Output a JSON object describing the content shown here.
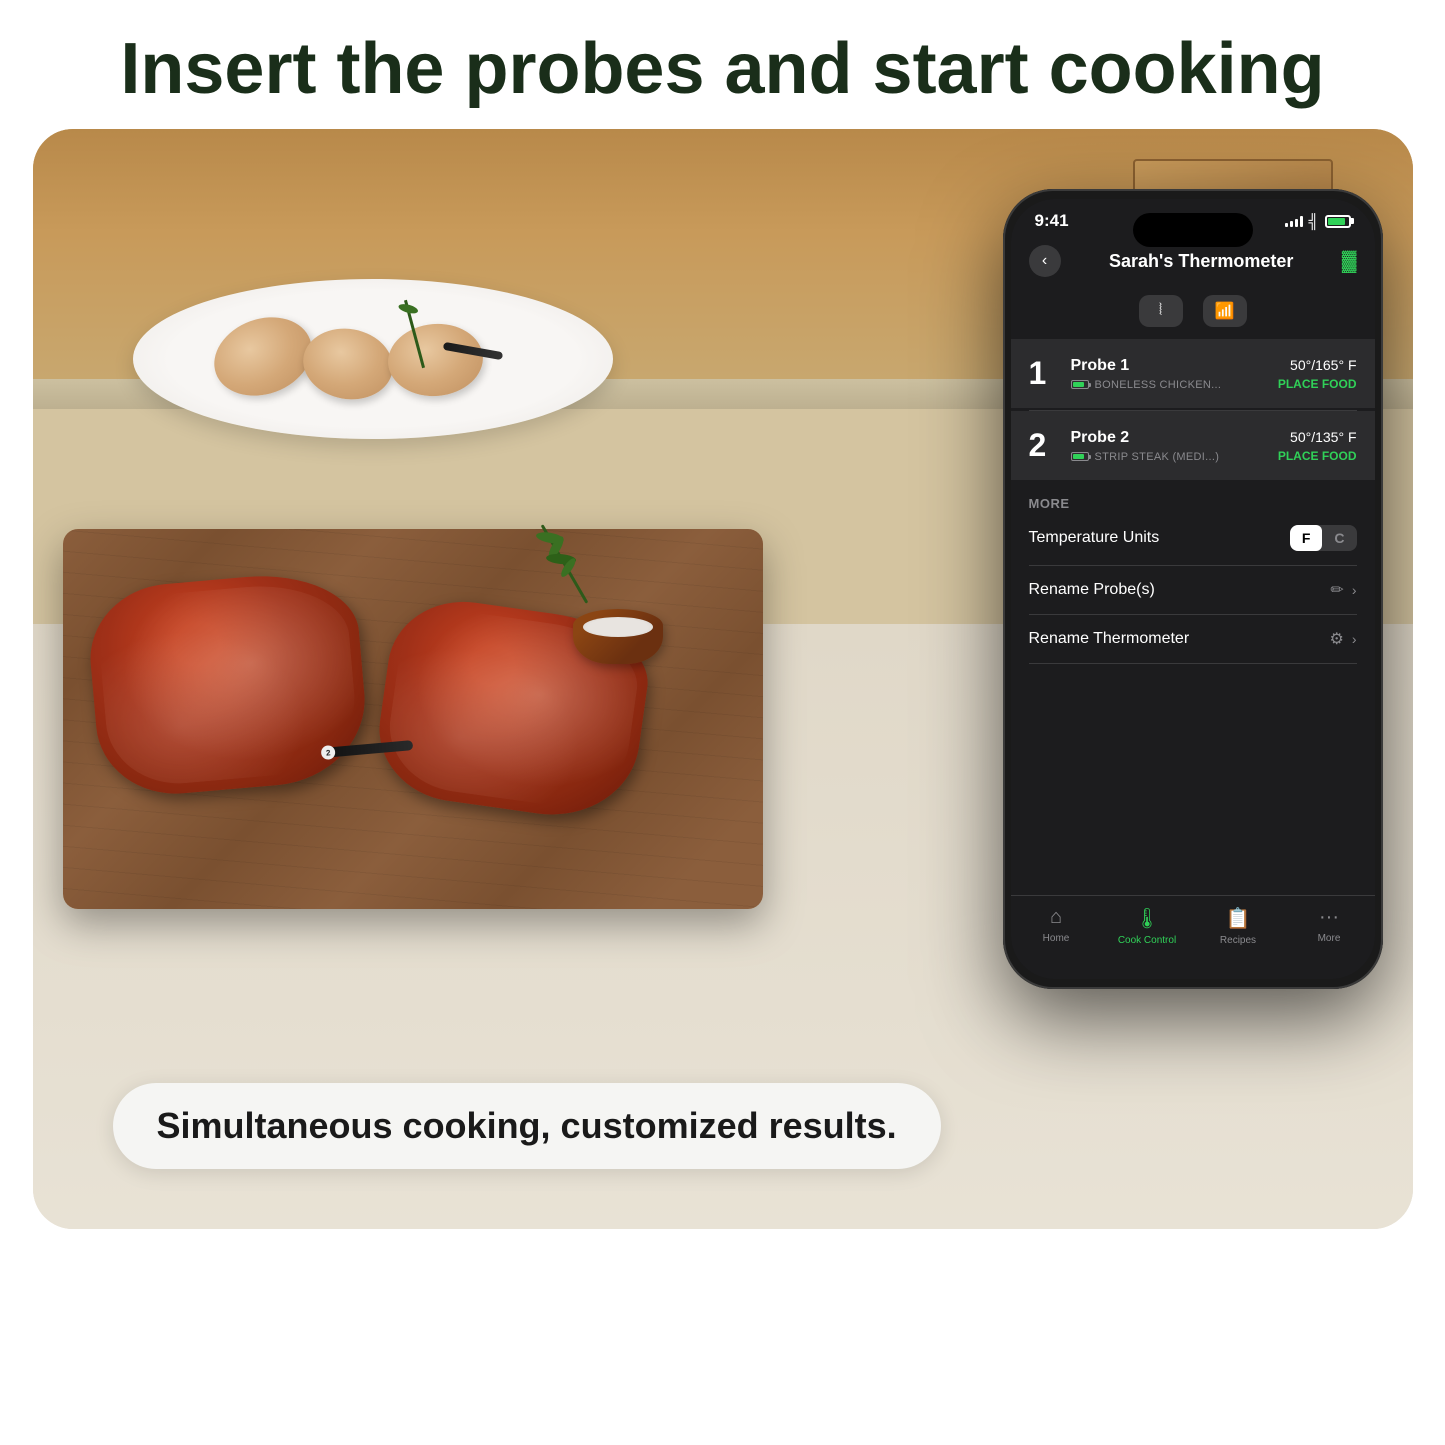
{
  "headline": "Insert the probes and start cooking",
  "tagline": "Simultaneous cooking, customized results.",
  "phone": {
    "status_time": "9:41",
    "title": "Sarah's Thermometer",
    "back_label": "‹",
    "battery_label": "🔋",
    "connectivity": {
      "bluetooth_label": "Bluetooth",
      "wifi_label": "WiFi"
    },
    "probes": [
      {
        "number": "1",
        "name": "Probe 1",
        "food": "BONELESS CHICKEN...",
        "temp": "50°/165° F",
        "status": "PLACE FOOD"
      },
      {
        "number": "2",
        "name": "Probe 2",
        "food": "STRIP STEAK (MEDI...)",
        "temp": "50°/135° F",
        "status": "PLACE FOOD"
      }
    ],
    "more_title": "MORE",
    "settings": [
      {
        "label": "Temperature Units",
        "type": "toggle",
        "options": [
          "F",
          "C"
        ],
        "active": "F"
      },
      {
        "label": "Rename Probe(s)",
        "type": "action"
      },
      {
        "label": "Rename Thermometer",
        "type": "action"
      }
    ],
    "nav_items": [
      {
        "label": "Home",
        "icon": "⌂",
        "active": false
      },
      {
        "label": "Cook Control",
        "icon": "🌡",
        "active": true
      },
      {
        "label": "Recipes",
        "icon": "📋",
        "active": false
      },
      {
        "label": "More",
        "icon": "···",
        "active": false
      }
    ]
  },
  "colors": {
    "accent_green": "#30d158",
    "dark_bg": "#1c1c1e",
    "headline_color": "#1a2e1a"
  }
}
